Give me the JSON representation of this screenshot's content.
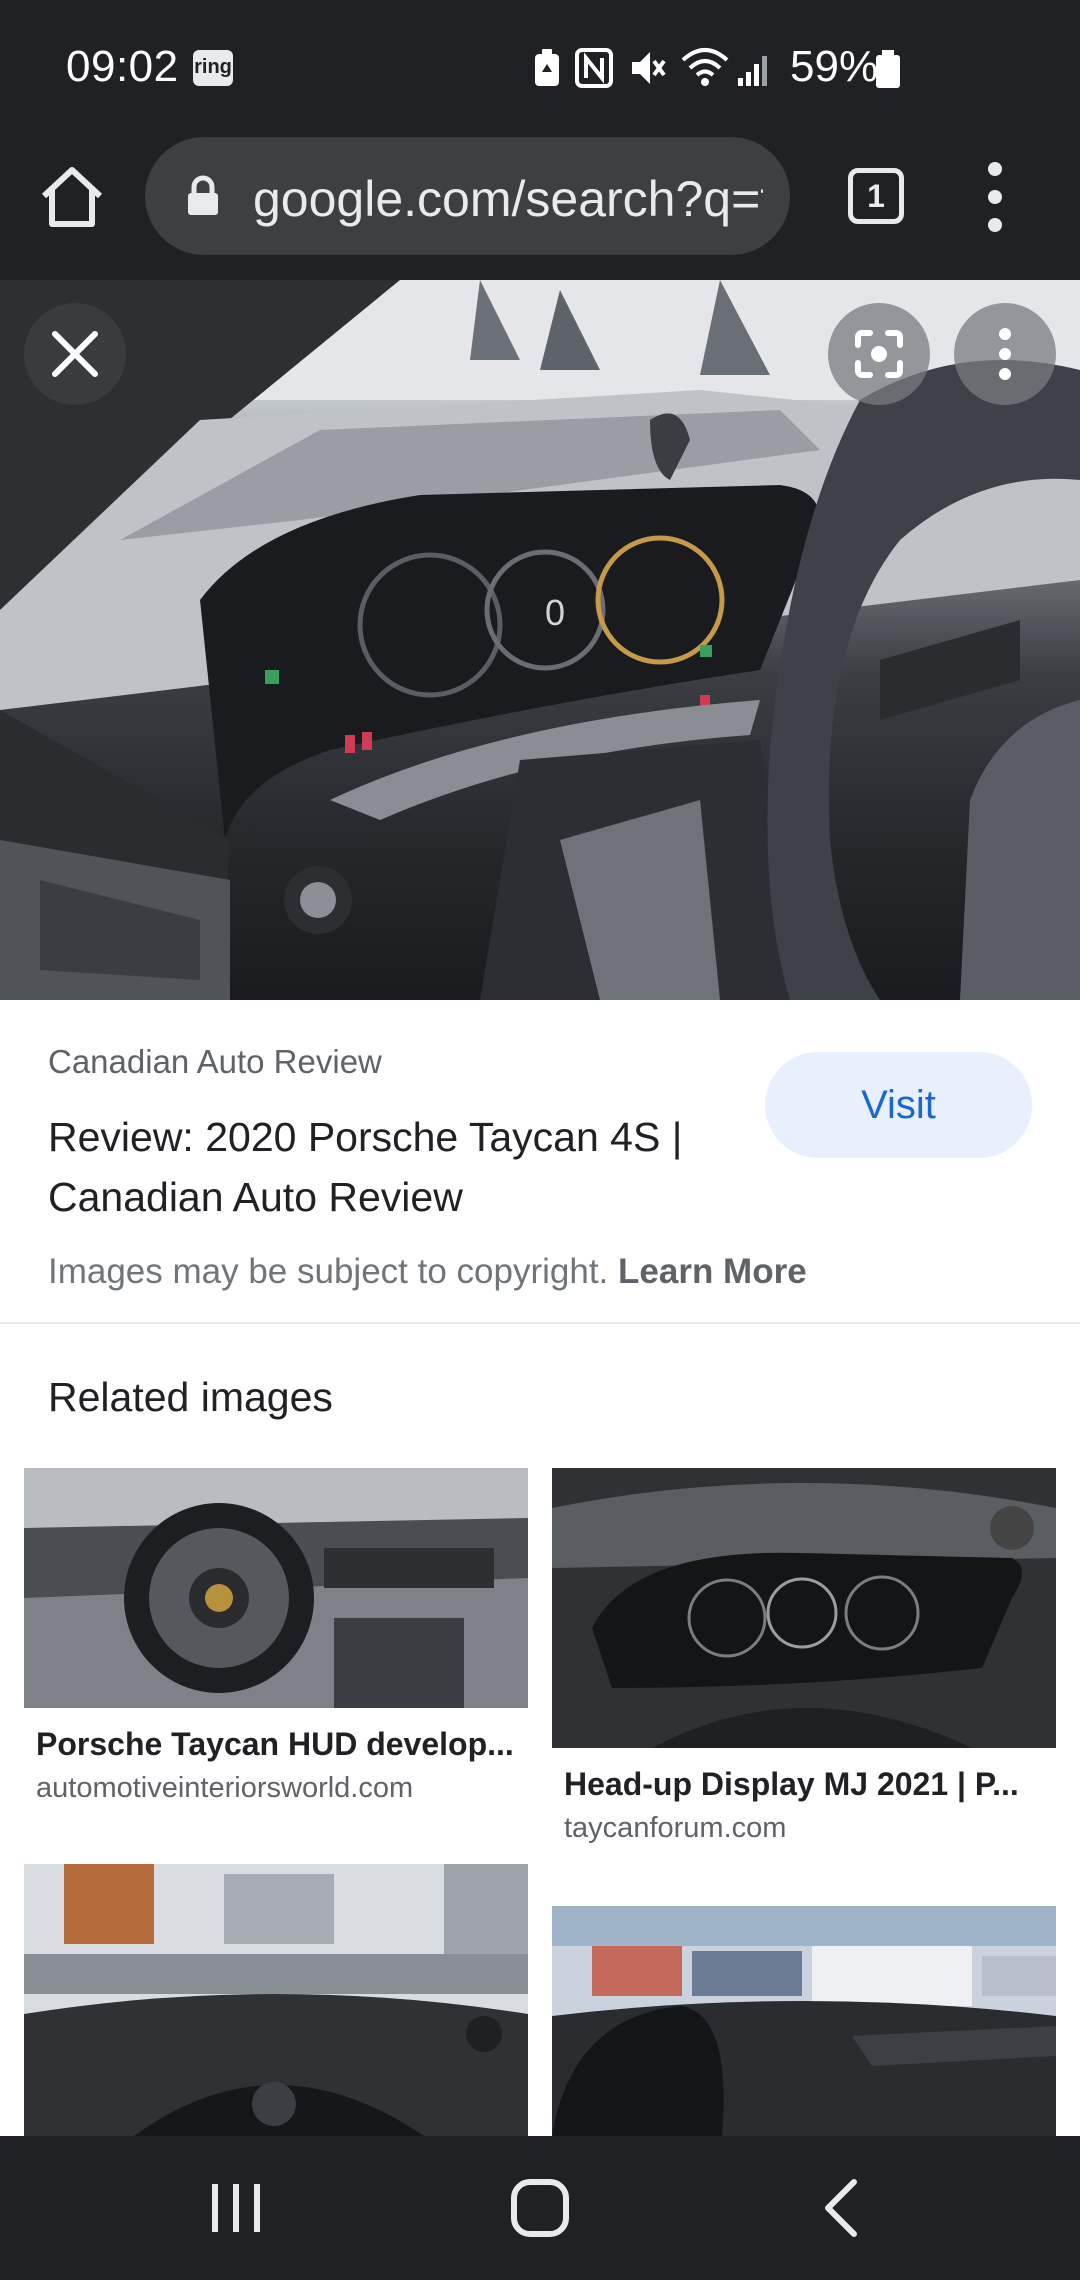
{
  "status_bar": {
    "time": "09:02",
    "ring_badge": "ring",
    "battery_percent": "59%",
    "icons": [
      "ring-app-icon",
      "battery-saver-icon",
      "nfc-icon",
      "mute-icon",
      "wifi-icon",
      "signal-icon",
      "battery-icon"
    ]
  },
  "toolbar": {
    "url": "google.com/search?q=taycan",
    "tab_count": "1"
  },
  "result": {
    "source": "Canadian Auto Review",
    "title": "Review: 2020 Porsche Taycan 4S | Canadian Auto Review",
    "visit_label": "Visit",
    "copyright_text": "Images may be subject to copyright.",
    "learn_more_label": "Learn More"
  },
  "related": {
    "heading": "Related images",
    "items": [
      {
        "title": "Porsche Taycan HUD develop...",
        "domain": "automotiveinteriorsworld.com"
      },
      {
        "title": "Head-up Display MJ 2021 | P...",
        "domain": "taycanforum.com"
      },
      {
        "title": "",
        "domain": ""
      },
      {
        "title": "",
        "domain": ""
      }
    ]
  },
  "colors": {
    "chrome_dark": "#202124",
    "url_pill": "#3c4043",
    "visit_bg": "#e8f0fe",
    "visit_text": "#1967d2"
  }
}
